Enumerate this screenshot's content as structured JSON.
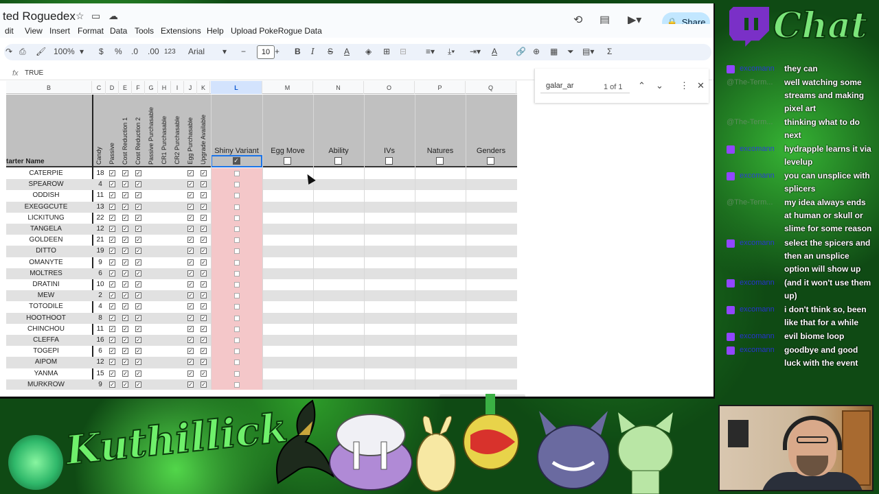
{
  "sheets": {
    "doc_title": "ted Roguedex",
    "menu": [
      "dit",
      "View",
      "Insert",
      "Format",
      "Data",
      "Tools",
      "Extensions",
      "Help",
      "Upload PokeRogue Data"
    ],
    "share_label": "Share",
    "toolbar": {
      "zoom": "100%",
      "currency": "$",
      "percent": "%",
      "dec_decrease": ".0",
      "dec_increase": ".00",
      "number_format": "123",
      "font": "Arial",
      "font_size": "10",
      "bold": "B",
      "italic": "I",
      "strike": "S",
      "text_color": "A",
      "text_color_b": "A",
      "sigma": "Σ"
    },
    "formula_bar": {
      "fx": "fx",
      "value": "TRUE"
    },
    "find": {
      "query": "galar_ar",
      "count": "1 of 1"
    },
    "column_letters": [
      "B",
      "C",
      "D",
      "E",
      "F",
      "G",
      "H",
      "I",
      "J",
      "K",
      "L",
      "M",
      "N",
      "O",
      "P",
      "Q"
    ],
    "selected_column": "L",
    "headers": {
      "starter_name": "tarter Name",
      "vertical": [
        "Candy",
        "Passive",
        "Cost Reduction 1",
        "Cost Reduction 2",
        "Passive Purchasable",
        "CR1 Purchasable",
        "CR2 Purchasable",
        "Egg Purchasable",
        "Upgrade Available"
      ],
      "horizontal": [
        "Shiny Variant",
        "Egg Move",
        "Ability",
        "IVs",
        "Natures",
        "Genders"
      ]
    },
    "rows": [
      {
        "name": "CATERPIE",
        "candy": "18"
      },
      {
        "name": "SPEAROW",
        "candy": "4"
      },
      {
        "name": "ODDISH",
        "candy": "11"
      },
      {
        "name": "EXEGGCUTE",
        "candy": "13"
      },
      {
        "name": "LICKITUNG",
        "candy": "22"
      },
      {
        "name": "TANGELA",
        "candy": "12"
      },
      {
        "name": "GOLDEEN",
        "candy": "21"
      },
      {
        "name": "DITTO",
        "candy": "19"
      },
      {
        "name": "OMANYTE",
        "candy": "9"
      },
      {
        "name": "MOLTRES",
        "candy": "6"
      },
      {
        "name": "DRATINI",
        "candy": "10"
      },
      {
        "name": "MEW",
        "candy": "2"
      },
      {
        "name": "TOTODILE",
        "candy": "4"
      },
      {
        "name": "HOOTHOOT",
        "candy": "8"
      },
      {
        "name": "CHINCHOU",
        "candy": "11"
      },
      {
        "name": "CLEFFA",
        "candy": "16"
      },
      {
        "name": "TOGEPI",
        "candy": "6"
      },
      {
        "name": "AIPOM",
        "candy": "12"
      },
      {
        "name": "YANMA",
        "candy": "15"
      },
      {
        "name": "MURKROW",
        "candy": "9"
      }
    ]
  },
  "chat": {
    "title": "Chat",
    "messages": [
      {
        "user": "excomann",
        "badge": true,
        "text": "they can"
      },
      {
        "user": "@The-Term...",
        "badge": false,
        "text": "well watching some streams and making pixel art"
      },
      {
        "user": "@The-Term...",
        "badge": false,
        "text": "thinking what to do next"
      },
      {
        "user": "excomann",
        "badge": true,
        "text": "hydrapple learns it via levelup"
      },
      {
        "user": "excomann",
        "badge": true,
        "text": "you can unsplice with splicers"
      },
      {
        "user": "@The-Term...",
        "badge": false,
        "text": "my idea always ends at human or skull or slime for some reason"
      },
      {
        "user": "excomann",
        "badge": true,
        "text": "select the spicers and then an unsplice option will show up"
      },
      {
        "user": "excomann",
        "badge": true,
        "text": "(and it won't use them up)"
      },
      {
        "user": "excomann",
        "badge": true,
        "text": "i don't think so, been like that for a while"
      },
      {
        "user": "excomann",
        "badge": true,
        "text": "evil biome loop"
      },
      {
        "user": "excomann",
        "badge": true,
        "text": "goodbye and good luck with the event"
      }
    ]
  },
  "overlay": {
    "streamer_name": "Kuthillick"
  },
  "colors": {
    "share_bg": "#c2e7ff",
    "shiny_column": "#f4c7c9",
    "header_gray": "#c0c0c0",
    "twitch_purple": "#9146ff",
    "accent_green": "#6ff06b"
  }
}
